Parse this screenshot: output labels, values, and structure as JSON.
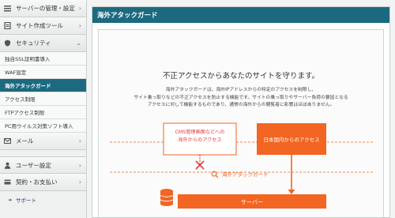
{
  "sidebar": {
    "server_management": "サーバーの管理・設定",
    "site_tools": "サイト作成ツール",
    "security": "セキュリティ",
    "security_items": [
      "独自SSL証明書導入",
      "WAF設定",
      "海外アタックガード",
      "アクセス制限",
      "FTPアクセス制限",
      "PC用ウイルス対策ソフト導入"
    ],
    "active_item_index": 2,
    "mail": "メール",
    "user_settings": "ユーザー設定",
    "contract_payment": "契約・お支払い",
    "support": "サポート"
  },
  "main": {
    "title": "海外アタックガード",
    "headline": "不正アクセスからあなたのサイトを守ります。",
    "description": [
      "海外アタックガードは、海外IPアドレスからの特定のアクセスを制限し、",
      "サイト乗っ取りなどの不正アクセスを防止する機能です。サイトの乗っ取りやサーバー負荷の要因となる",
      "アクセスに対して機能するものであり、通常の海外からの閲覧者に影響はほぼありません。"
    ]
  },
  "diagram": {
    "overseas_access": [
      "CMS管理画面などへの",
      "海外からのアクセス"
    ],
    "domestic_access": "日本国内からのアクセス",
    "guard_label": "海外アタックガード",
    "server_label": "サーバー",
    "accent_color": "#f26522",
    "blocked_color": "#e23b3b",
    "icons": [
      "block-x-icon",
      "search-icon",
      "database-icon"
    ]
  }
}
